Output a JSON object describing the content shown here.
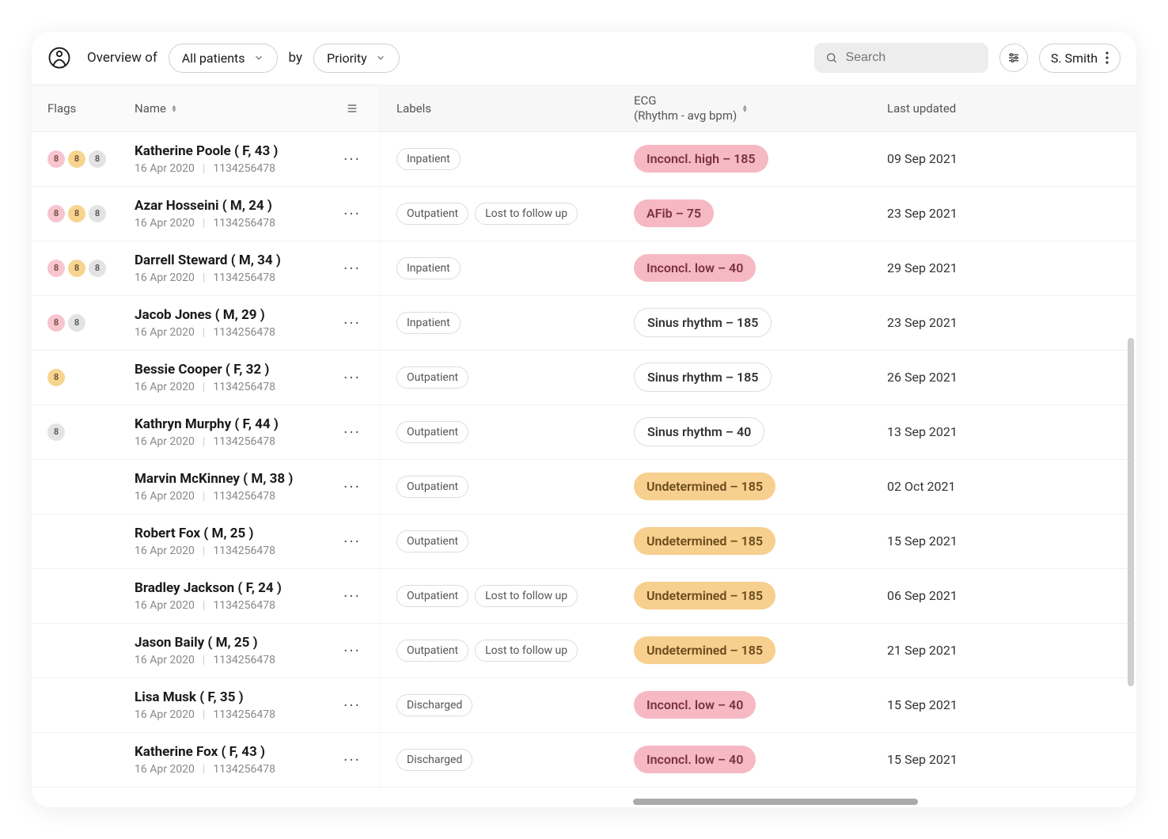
{
  "header": {
    "overview_prefix": "Overview of",
    "filter_patients": "All patients",
    "by_label": "by",
    "sort_by": "Priority",
    "search_placeholder": "Search",
    "user_name": "S. Smith"
  },
  "columns": {
    "flags": "Flags",
    "name": "Name",
    "labels": "Labels",
    "ecg_line1": "ECG",
    "ecg_line2": "(Rhythm - avg bpm)",
    "updated": "Last updated"
  },
  "flag_colors": {
    "pink": "pink",
    "amber": "amber",
    "grey": "grey"
  },
  "rows": [
    {
      "flags": [
        {
          "v": "8",
          "c": "pink"
        },
        {
          "v": "8",
          "c": "amber"
        },
        {
          "v": "8",
          "c": "grey"
        }
      ],
      "name": "Katherine Poole",
      "meta": "( F, 43 )",
      "date": "16 Apr 2020",
      "mrn": "1134256478",
      "labels": [
        "Inpatient"
      ],
      "ecg": {
        "text": "Inconcl. high – 185",
        "style": "pink"
      },
      "updated": "09 Sep 2021"
    },
    {
      "flags": [
        {
          "v": "8",
          "c": "pink"
        },
        {
          "v": "8",
          "c": "amber"
        },
        {
          "v": "8",
          "c": "grey"
        }
      ],
      "name": "Azar Hosseini",
      "meta": "( M, 24 )",
      "date": "16 Apr 2020",
      "mrn": "1134256478",
      "labels": [
        "Outpatient",
        "Lost to follow up"
      ],
      "ecg": {
        "text": "AFib – 75",
        "style": "pink"
      },
      "updated": "23 Sep 2021"
    },
    {
      "flags": [
        {
          "v": "8",
          "c": "pink"
        },
        {
          "v": "8",
          "c": "amber"
        },
        {
          "v": "8",
          "c": "grey"
        }
      ],
      "name": "Darrell Steward",
      "meta": "( M, 34 )",
      "date": "16 Apr 2020",
      "mrn": "1134256478",
      "labels": [
        "Inpatient"
      ],
      "ecg": {
        "text": "Inconcl. low – 40",
        "style": "pink"
      },
      "updated": "29 Sep 2021"
    },
    {
      "flags": [
        {
          "v": "8",
          "c": "pink"
        },
        {
          "v": "8",
          "c": "grey"
        }
      ],
      "name": "Jacob Jones",
      "meta": "( M, 29 )",
      "date": "16 Apr 2020",
      "mrn": "1134256478",
      "labels": [
        "Inpatient"
      ],
      "ecg": {
        "text": "Sinus rhythm – 185",
        "style": "plain"
      },
      "updated": "23 Sep 2021"
    },
    {
      "flags": [
        {
          "v": "8",
          "c": "amber"
        }
      ],
      "name": "Bessie Cooper",
      "meta": "( F, 32 )",
      "date": "16 Apr 2020",
      "mrn": "1134256478",
      "labels": [
        "Outpatient"
      ],
      "ecg": {
        "text": "Sinus rhythm – 185",
        "style": "plain"
      },
      "updated": "26 Sep 2021"
    },
    {
      "flags": [
        {
          "v": "8",
          "c": "grey"
        }
      ],
      "name": "Kathryn Murphy",
      "meta": "( F, 44 )",
      "date": "16 Apr 2020",
      "mrn": "1134256478",
      "labels": [
        "Outpatient"
      ],
      "ecg": {
        "text": "Sinus rhythm – 40",
        "style": "plain"
      },
      "updated": "13 Sep 2021"
    },
    {
      "flags": [],
      "name": "Marvin McKinney",
      "meta": "( M, 38 )",
      "date": "16 Apr 2020",
      "mrn": "1134256478",
      "labels": [
        "Outpatient"
      ],
      "ecg": {
        "text": "Undetermined – 185",
        "style": "amber"
      },
      "updated": "02 Oct 2021"
    },
    {
      "flags": [],
      "name": "Robert Fox",
      "meta": "( M, 25 )",
      "date": "16 Apr 2020",
      "mrn": "1134256478",
      "labels": [
        "Outpatient"
      ],
      "ecg": {
        "text": "Undetermined – 185",
        "style": "amber"
      },
      "updated": "15 Sep 2021"
    },
    {
      "flags": [],
      "name": "Bradley Jackson",
      "meta": "( F, 24 )",
      "date": "16 Apr 2020",
      "mrn": "1134256478",
      "labels": [
        "Outpatient",
        "Lost to follow up"
      ],
      "ecg": {
        "text": "Undetermined – 185",
        "style": "amber"
      },
      "updated": "06 Sep 2021"
    },
    {
      "flags": [],
      "name": "Jason Baily",
      "meta": "( M, 25 )",
      "date": "16 Apr 2020",
      "mrn": "1134256478",
      "labels": [
        "Outpatient",
        "Lost to follow up"
      ],
      "ecg": {
        "text": "Undetermined – 185",
        "style": "amber"
      },
      "updated": "21 Sep 2021"
    },
    {
      "flags": [],
      "name": "Lisa Musk",
      "meta": "( F, 35 )",
      "date": "16 Apr 2020",
      "mrn": "1134256478",
      "labels": [
        "Discharged"
      ],
      "ecg": {
        "text": "Inconcl. low – 40",
        "style": "pink"
      },
      "updated": "15 Sep 2021"
    },
    {
      "flags": [],
      "name": "Katherine Fox",
      "meta": "( F, 43 )",
      "date": "16 Apr 2020",
      "mrn": "1134256478",
      "labels": [
        "Discharged"
      ],
      "ecg": {
        "text": "Inconcl. low – 40",
        "style": "pink"
      },
      "updated": "15 Sep 2021"
    }
  ]
}
